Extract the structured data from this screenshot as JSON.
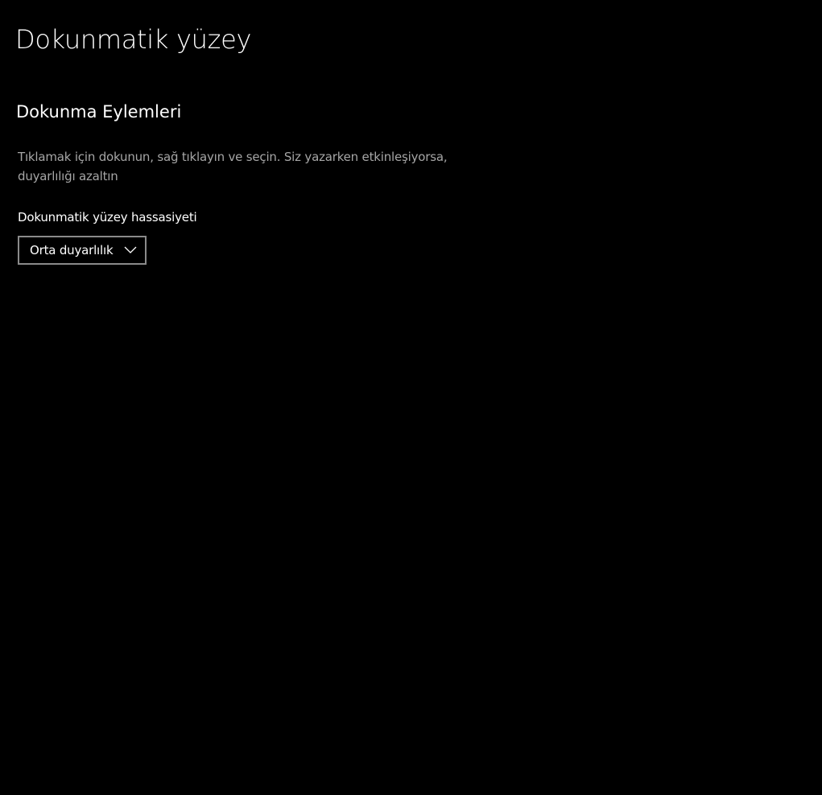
{
  "page": {
    "title": "Dokunmatik yüzey"
  },
  "section": {
    "title": "Dokunma Eylemleri",
    "description": "Tıklamak için dokunun, sağ tıklayın ve seçin. Siz yazarken etkinleşiyorsa, duyarlılığı azaltın"
  },
  "sensitivity": {
    "label": "Dokunmatik yüzey hassasiyeti",
    "selected": "Orta duyarlılık",
    "icon": "chevron-down-icon"
  },
  "colors": {
    "background": "#000000",
    "text": "#ffffff",
    "secondary_text": "#a6a6a6",
    "dropdown_border": "#8a8a8a"
  }
}
